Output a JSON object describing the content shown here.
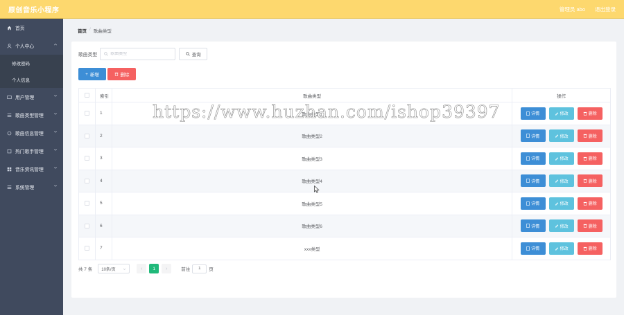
{
  "header": {
    "app_title": "原创音乐小程序",
    "user_text": "管理员 abo",
    "logout": "退出登录"
  },
  "sidebar": {
    "items": [
      {
        "label": "首页",
        "icon": "home-icon"
      },
      {
        "label": "个人中心",
        "icon": "user-icon",
        "expanded": true
      },
      {
        "label": "修改密码",
        "sub": true
      },
      {
        "label": "个人信息",
        "sub": true
      },
      {
        "label": "用户管理",
        "icon": "users-icon"
      },
      {
        "label": "歌曲类型管理",
        "icon": "tag-icon"
      },
      {
        "label": "歌曲信息管理",
        "icon": "circle-icon"
      },
      {
        "label": "热门歌手管理",
        "icon": "star-icon"
      },
      {
        "label": "音乐资讯管理",
        "icon": "news-icon"
      },
      {
        "label": "系统管理",
        "icon": "menu-icon"
      }
    ]
  },
  "breadcrumb": {
    "home": "首页",
    "sep": "/",
    "current": "歌曲类型"
  },
  "search": {
    "label": "歌曲类型",
    "placeholder": "歌曲类型",
    "button": "查询"
  },
  "actions": {
    "add": "新增",
    "delete": "删除"
  },
  "table": {
    "headers": {
      "index": "索引",
      "name": "歌曲类型",
      "ops": "操作"
    },
    "rows": [
      {
        "index": "1",
        "name": "歌曲类型1"
      },
      {
        "index": "2",
        "name": "歌曲类型2"
      },
      {
        "index": "3",
        "name": "歌曲类型3"
      },
      {
        "index": "4",
        "name": "歌曲类型4"
      },
      {
        "index": "5",
        "name": "歌曲类型5"
      },
      {
        "index": "6",
        "name": "歌曲类型6"
      },
      {
        "index": "7",
        "name": "xxx类型"
      }
    ],
    "row_ops": {
      "detail": "详情",
      "edit": "修改",
      "delete": "删除"
    }
  },
  "pagination": {
    "total": "共 7 条",
    "page_size": "10条/页",
    "current_page": "1",
    "goto_prefix": "前往",
    "goto_value": "1",
    "goto_suffix": "页"
  },
  "watermark": "https://www.huzhan.com/ishop39397",
  "colors": {
    "header_bg": "#fdd86e",
    "sidebar_bg": "#404a5e",
    "primary": "#3d8ed6",
    "danger": "#f56161",
    "info": "#5ec2de",
    "success": "#20b97a"
  }
}
